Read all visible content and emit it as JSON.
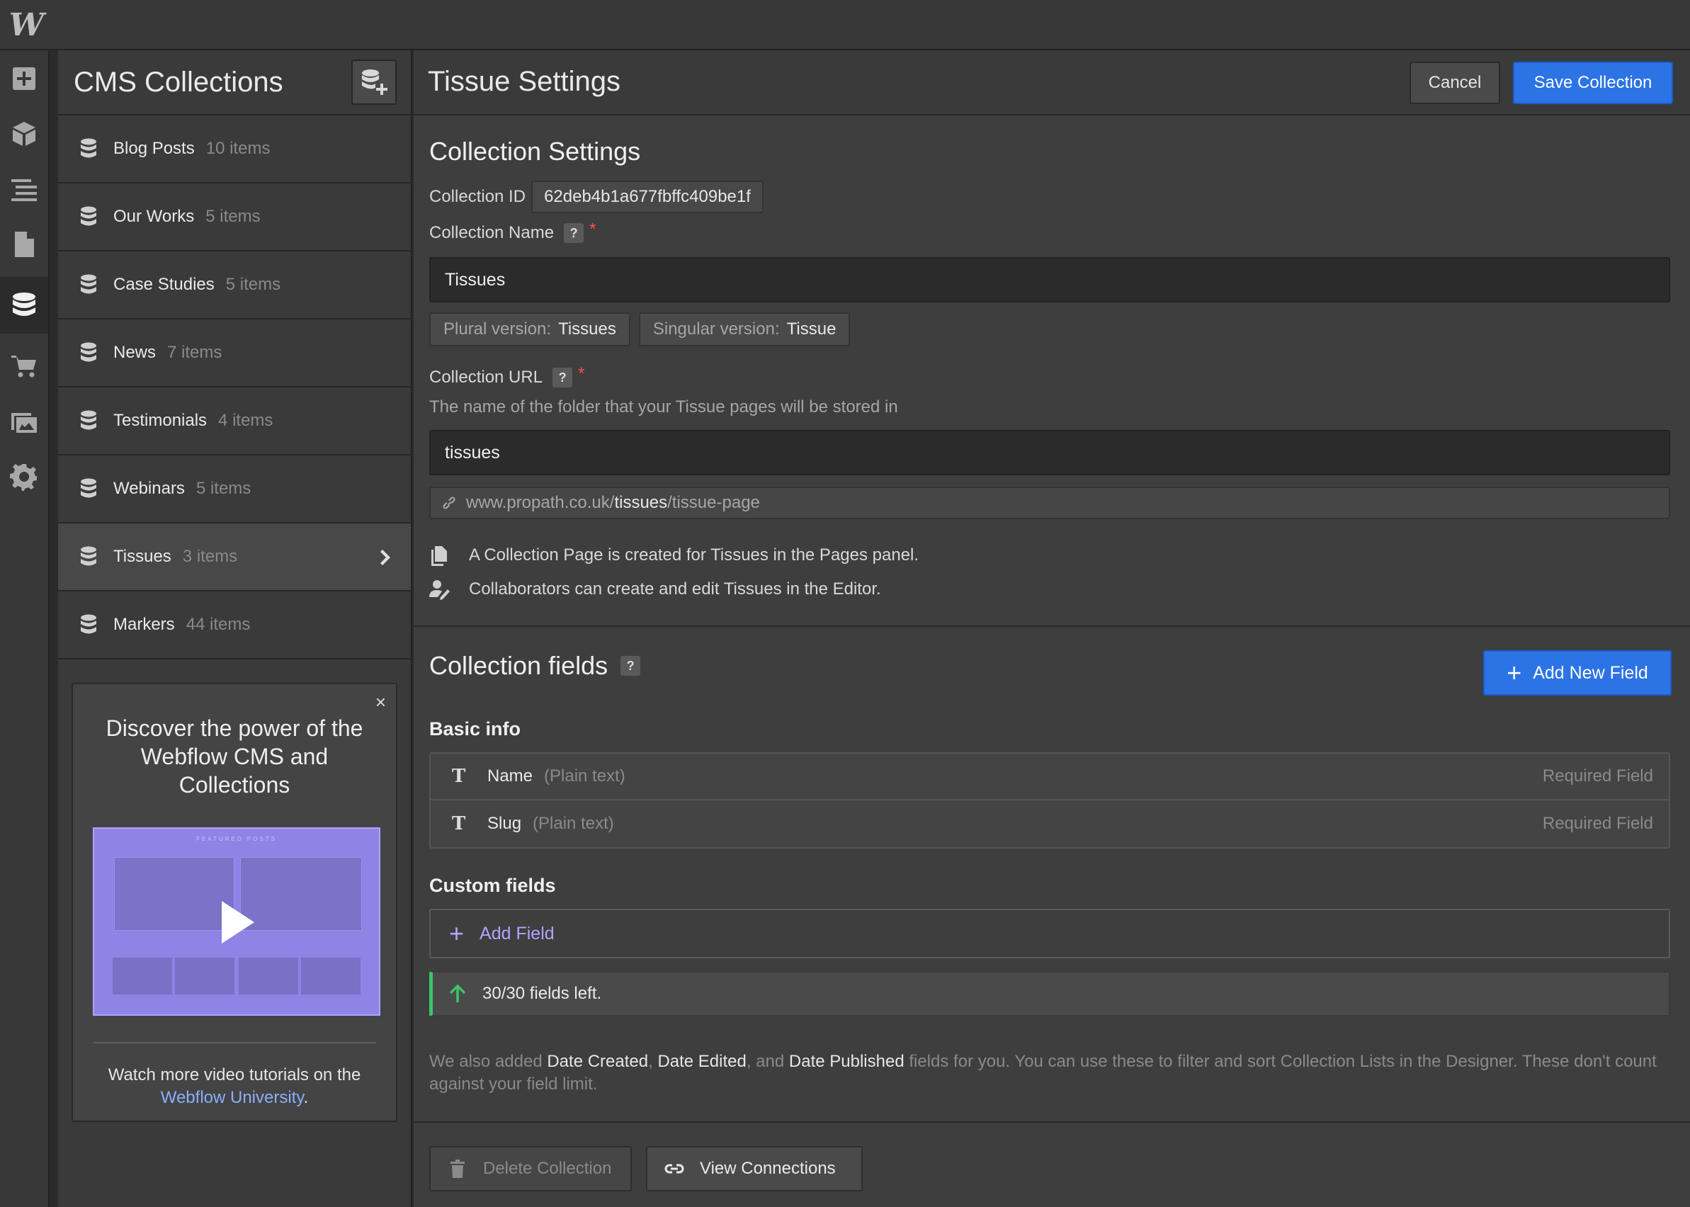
{
  "app": {
    "logo": "W"
  },
  "rail": [
    {
      "name": "add-icon",
      "active": false
    },
    {
      "name": "cube-icon",
      "active": false
    },
    {
      "name": "navigator-icon",
      "active": false
    },
    {
      "name": "pages-icon",
      "active": false
    },
    {
      "name": "cms-database-icon",
      "active": true
    },
    {
      "name": "ecommerce-cart-icon",
      "active": false
    },
    {
      "name": "assets-images-icon",
      "active": false
    },
    {
      "name": "settings-gear-icon",
      "active": false
    }
  ],
  "collections_panel": {
    "title": "CMS Collections",
    "items": [
      {
        "name": "Blog Posts",
        "count": "10 items"
      },
      {
        "name": "Our Works",
        "count": "5 items"
      },
      {
        "name": "Case Studies",
        "count": "5 items"
      },
      {
        "name": "News",
        "count": "7 items"
      },
      {
        "name": "Testimonials",
        "count": "4 items"
      },
      {
        "name": "Webinars",
        "count": "5 items"
      },
      {
        "name": "Tissues",
        "count": "3 items",
        "active": true
      },
      {
        "name": "Markers",
        "count": "44 items"
      }
    ],
    "promo": {
      "close": "×",
      "title": "Discover the power of the Webflow CMS and Collections",
      "video_label": "FEATURED POSTS",
      "text_before": "Watch more video tutorials on the",
      "link": "Webflow University",
      "text_after": "."
    }
  },
  "main": {
    "title": "Tissue Settings",
    "cancel_label": "Cancel",
    "save_label": "Save Collection",
    "settings": {
      "heading": "Collection Settings",
      "id_label": "Collection ID",
      "id_value": "62deb4b1a677fbffc409be1f",
      "name_label": "Collection Name",
      "help": "?",
      "required_mark": "*",
      "name_value": "Tissues",
      "plural_label": "Plural version:",
      "plural_value": "Tissues",
      "singular_label": "Singular version:",
      "singular_value": "Tissue",
      "url_label": "Collection URL",
      "url_desc": "The name of the folder that your Tissue pages will be stored in",
      "url_value": "tissues",
      "url_preview_domain": "www.propath.co.uk/",
      "url_preview_folder": "tissues",
      "url_preview_page": "/tissue-page",
      "info_page": "A Collection Page is created for Tissues in the Pages panel.",
      "info_editor": "Collaborators can create and edit Tissues in the Editor."
    },
    "fields": {
      "heading": "Collection fields",
      "add_new_label": "Add New Field",
      "basic_heading": "Basic info",
      "basic": [
        {
          "icon": "T",
          "name": "Name",
          "type": "(Plain text)",
          "req": "Required Field"
        },
        {
          "icon": "T",
          "name": "Slug",
          "type": "(Plain text)",
          "req": "Required Field"
        }
      ],
      "custom_heading": "Custom fields",
      "add_field_label": "Add Field",
      "left_text": "30/30 fields left.",
      "note": {
        "p1": "We also added ",
        "d1": "Date Created",
        "p2": ", ",
        "d2": "Date Edited",
        "p3": ", and ",
        "d3": "Date Published",
        "p4": " fields for you. You can use these to filter and sort Collection Lists in the Designer. These don't count against your field limit."
      }
    },
    "footer": {
      "delete_label": "Delete Collection",
      "connections_label": "View Connections"
    }
  },
  "colors": {
    "accent": "#2c73e5",
    "purple": "#b0a4ff",
    "success": "#3cc46a",
    "required": "#ff4c4c"
  }
}
